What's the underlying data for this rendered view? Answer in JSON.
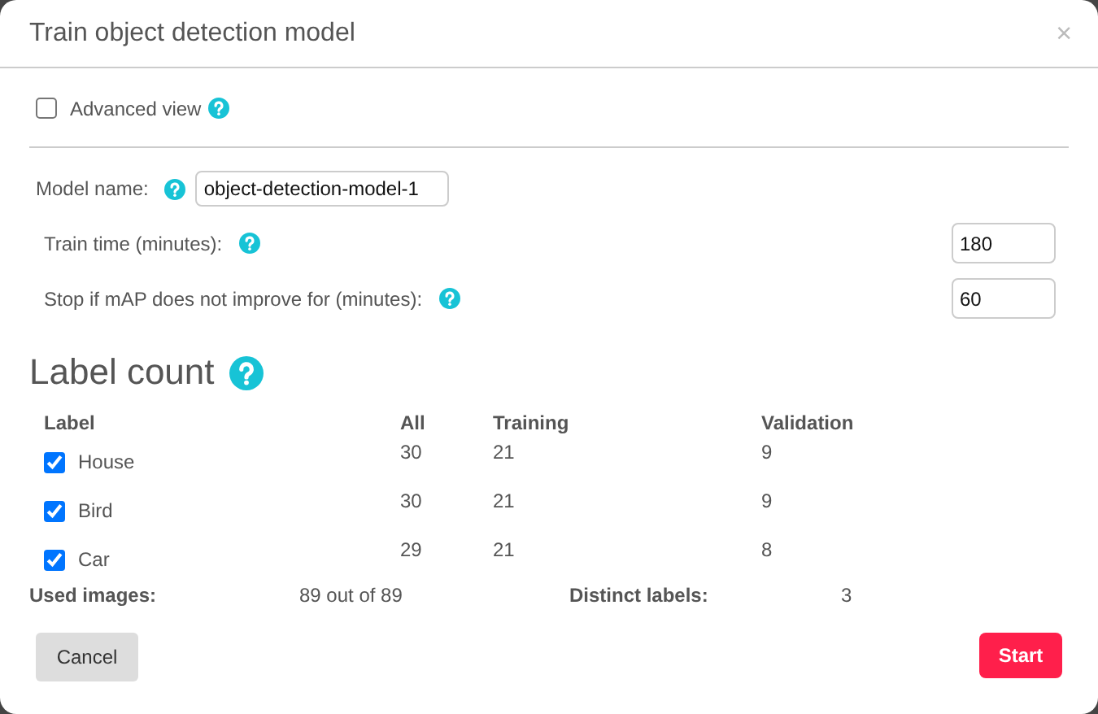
{
  "dialog": {
    "title": "Train object detection model",
    "close": "×"
  },
  "advanced_view": {
    "label": "Advanced view",
    "checked": false
  },
  "fields": [
    {
      "label": "Model name:",
      "value": "object-detection-model-1",
      "kind": "inline"
    },
    {
      "label": "Train time (minutes):",
      "value": "180",
      "kind": "right"
    },
    {
      "label": "Stop if mAP does not improve for (minutes):",
      "value": "60",
      "kind": "right"
    }
  ],
  "label_count": {
    "heading": "Label count",
    "columns": [
      "Label",
      "All",
      "Training",
      "Validation"
    ],
    "rows": [
      {
        "label": "House",
        "checked": true,
        "all": "30",
        "training": "21",
        "validation": "9"
      },
      {
        "label": "Bird",
        "checked": true,
        "all": "30",
        "training": "21",
        "validation": "9"
      },
      {
        "label": "Car",
        "checked": true,
        "all": "29",
        "training": "21",
        "validation": "8"
      }
    ],
    "summary": [
      {
        "label": "Used images:",
        "value": "89 out of 89"
      },
      {
        "label": "Distinct labels:",
        "value": "3"
      }
    ]
  },
  "buttons": {
    "cancel": "Cancel",
    "start": "Start"
  }
}
